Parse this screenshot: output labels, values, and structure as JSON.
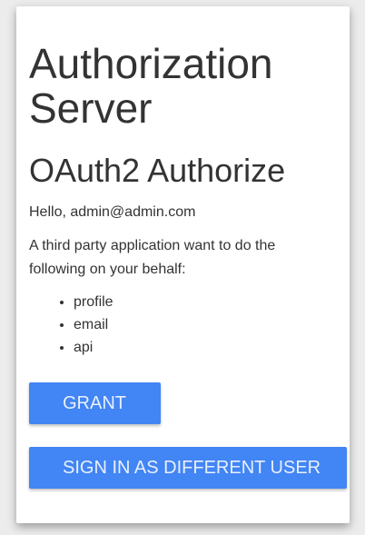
{
  "header": {
    "title": "Authorization Server",
    "subtitle": "OAuth2 Authorize"
  },
  "greeting": "Hello, admin@admin.com",
  "message": "A third party application want to do the following on your behalf:",
  "scopes": [
    "profile",
    "email",
    "api"
  ],
  "buttons": {
    "grant": "GRANT",
    "different_user": "SIGN IN AS DIFFERENT USER"
  },
  "colors": {
    "primary": "#4285f4",
    "text": "#333333",
    "background": "#ececec"
  }
}
